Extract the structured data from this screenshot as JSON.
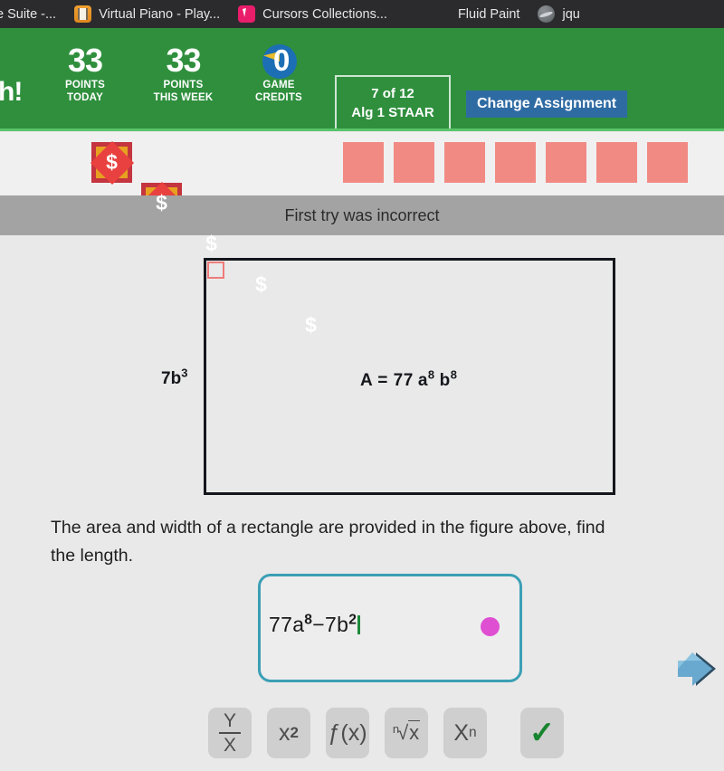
{
  "browser": {
    "tabs": [
      {
        "title": "e Suite -...",
        "icon": "none"
      },
      {
        "title": "Virtual Piano - Play...",
        "icon": "piano-icon"
      },
      {
        "title": "Cursors Collections...",
        "icon": "cursor-icon"
      },
      {
        "title": "Fluid Paint",
        "icon": "none"
      },
      {
        "title": "jqu",
        "icon": "globe-icon"
      }
    ]
  },
  "header": {
    "logo": "h!",
    "stats": [
      {
        "value": "33",
        "label_line1": "POINTS",
        "label_line2": "TODAY"
      },
      {
        "value": "33",
        "label_line1": "POINTS",
        "label_line2": "THIS WEEK"
      },
      {
        "value": "0",
        "label_line1": "GAME",
        "label_line2": "CREDITS"
      }
    ],
    "assignment": {
      "progress": "7 of 12",
      "name": "Alg 1 STAAR"
    },
    "change_assignment_label": "Change Assignment",
    "accent_green": "#2f8f3d",
    "button_blue": "#2f6ba3"
  },
  "progress_tokens": {
    "total": 12,
    "earned": 5,
    "current_index": 5,
    "token_glyph": "$",
    "filled_color": "#e8a021",
    "empty_color": "#f28a84",
    "highlight_color": "#1f8fc8"
  },
  "status": {
    "message": "First try was incorrect",
    "bar_color": "#a3a3a3"
  },
  "figure": {
    "width_label": {
      "base": "7b",
      "exponent": "3"
    },
    "area_label": {
      "prefix": "A = 77",
      "var1": "a",
      "exp1": "8",
      "var2": "b",
      "exp2": "8"
    },
    "right_angle_marker": "right-angle-marker"
  },
  "question": {
    "line1": "The area and width of a rectangle are provided in the figure above, find",
    "line2": "the length."
  },
  "answer": {
    "value_a_coeff": "77",
    "value_a_var": "a",
    "value_a_exp": "8",
    "value_minus": "−",
    "value_b_coeff": "7",
    "value_b_var": "b",
    "value_b_exp": "2",
    "border_color": "#3b9fb5",
    "dot_color": "#df4fd2",
    "caret_color": "#1f8a3b"
  },
  "math_toolbar": {
    "buttons": [
      {
        "name": "fraction-button",
        "numerator": "Y",
        "denominator": "X"
      },
      {
        "name": "square-button",
        "base": "x",
        "exponent": "2"
      },
      {
        "name": "function-button",
        "label": "ƒ(x)"
      },
      {
        "name": "nth-root-button",
        "index": "n",
        "radicand": "x"
      },
      {
        "name": "subscript-button",
        "base": "X",
        "subscript": "n"
      },
      {
        "name": "submit-button",
        "label": "✓"
      }
    ]
  },
  "navigation": {
    "next_arrow": "next-arrow-icon"
  }
}
